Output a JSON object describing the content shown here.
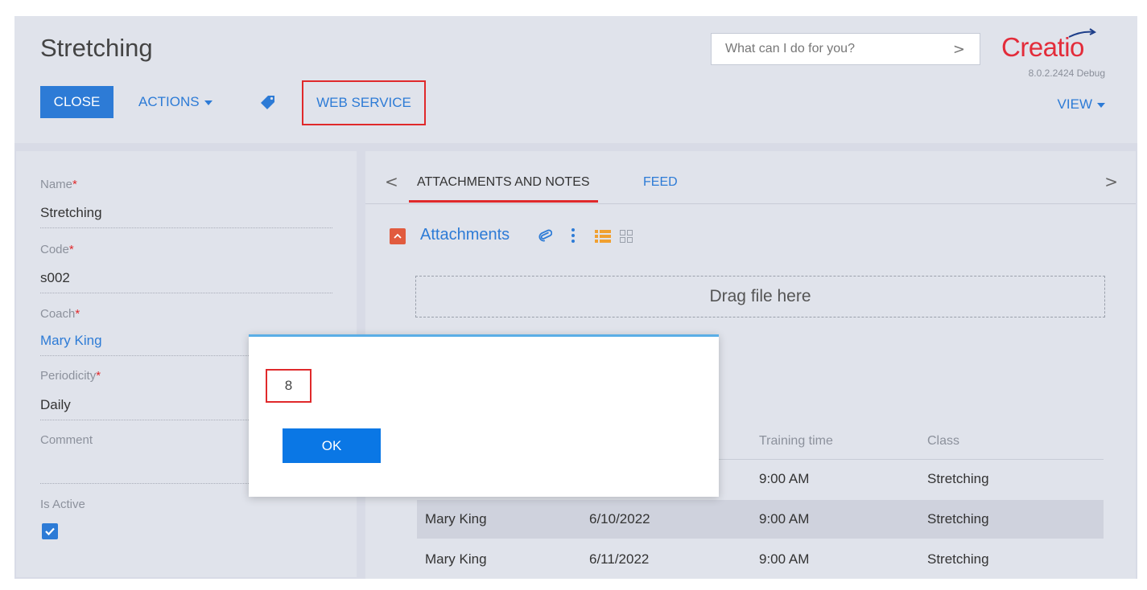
{
  "header": {
    "page_title": "Stretching",
    "close_label": "CLOSE",
    "actions_label": "ACTIONS",
    "webservice_label": "WEB SERVICE",
    "search_placeholder": "What can I do for you?",
    "logo_text": "Creatio",
    "version": "8.0.2.2424 Debug",
    "view_label": "VIEW"
  },
  "form": {
    "name": {
      "label": "Name",
      "value": "Stretching"
    },
    "code": {
      "label": "Code",
      "value": "s002"
    },
    "coach": {
      "label": "Coach",
      "value": "Mary King"
    },
    "periodicity": {
      "label": "Periodicity",
      "value": "Daily"
    },
    "comment": {
      "label": "Comment",
      "value": ""
    },
    "is_active": {
      "label": "Is Active",
      "checked": true
    },
    "required_mark": "*"
  },
  "tabs": {
    "items": [
      {
        "label": "ATTACHMENTS AND NOTES",
        "active": true
      },
      {
        "label": "FEED",
        "active": false
      }
    ]
  },
  "attachments": {
    "title": "Attachments",
    "dropzone_text": "Drag file here"
  },
  "schedule": {
    "columns": [
      "Training time",
      "Class"
    ],
    "rows": [
      {
        "coach": "",
        "date": "",
        "time": "9:00 AM",
        "class": "Stretching"
      },
      {
        "coach": "Mary King",
        "date": "6/10/2022",
        "time": "9:00 AM",
        "class": "Stretching"
      },
      {
        "coach": "Mary King",
        "date": "6/11/2022",
        "time": "9:00 AM",
        "class": "Stretching"
      }
    ]
  },
  "modal": {
    "message": "8",
    "ok_label": "OK"
  },
  "colors": {
    "accent": "#2d7bd6",
    "brand": "#e32c3a",
    "highlight": "#e0292b",
    "ok_button": "#0a77e5"
  }
}
